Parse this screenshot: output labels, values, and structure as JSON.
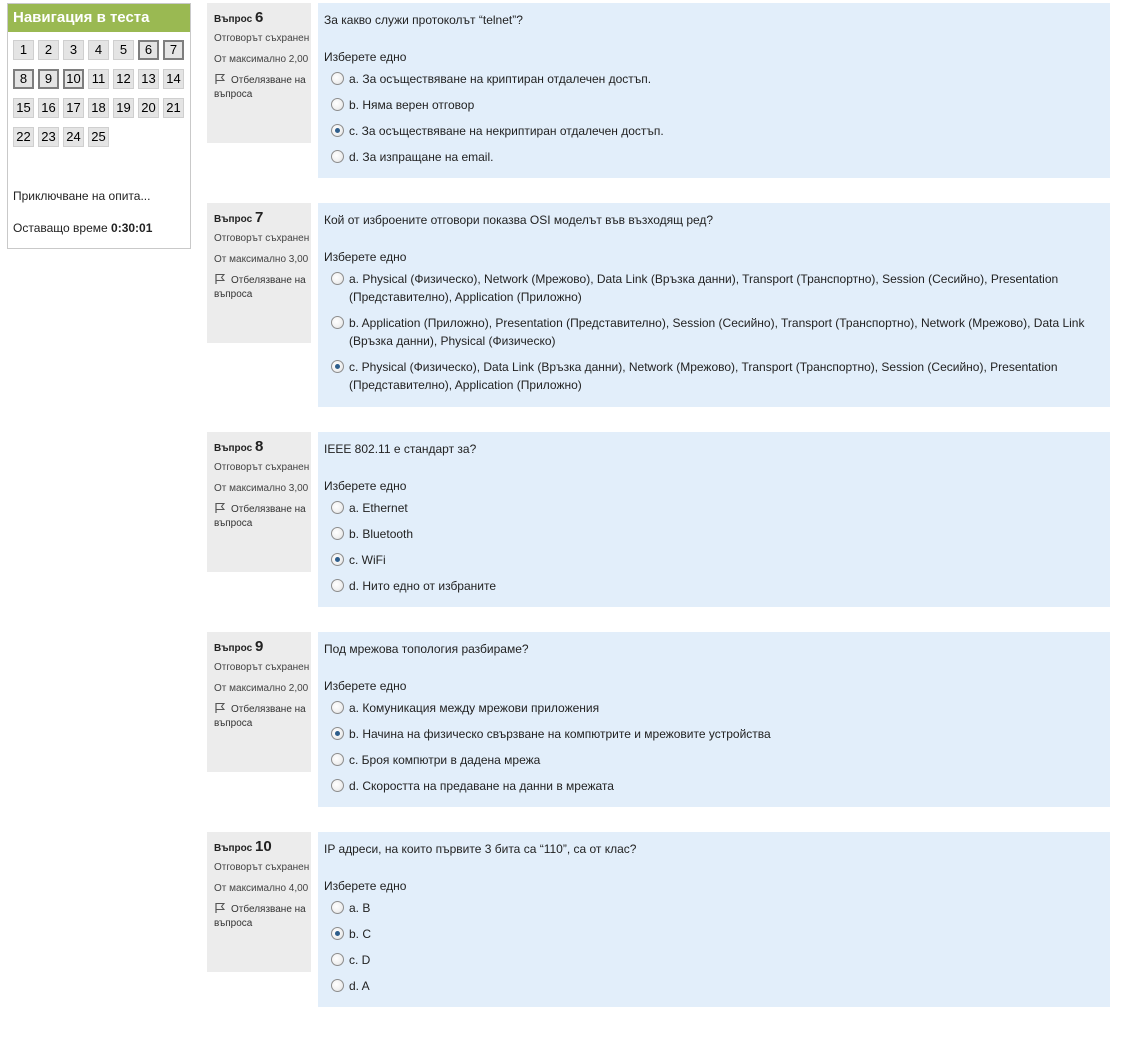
{
  "nav": {
    "title": "Навигация в теста",
    "buttons": [
      "1",
      "2",
      "3",
      "4",
      "5",
      "6",
      "7",
      "8",
      "9",
      "10",
      "11",
      "12",
      "13",
      "14",
      "15",
      "16",
      "17",
      "18",
      "19",
      "20",
      "21",
      "22",
      "23",
      "24",
      "25"
    ],
    "finish_label": "Приключване на опита...",
    "timer_label": "Оставащо време",
    "timer_value": "0:30:01"
  },
  "questions": [
    {
      "label": "Въпрос",
      "number": "6",
      "state": "Отговорът съхранен",
      "grade": "От максимално 2,00",
      "flag": "Отбелязване на въпроса",
      "text": "За какво служи протоколът “telnet”?",
      "prompt": "Изберете едно",
      "answers": [
        "a. За осъществяване на криптиран отдалечен достъп.",
        "b. Няма верен отговор",
        "c. За осъществяване на некриптиран отдалечен достъп.",
        "d. За изпращане на email."
      ],
      "selected": "c"
    },
    {
      "label": "Въпрос",
      "number": "7",
      "state": "Отговорът съхранен",
      "grade": "От максимално 3,00",
      "flag": "Отбелязване на въпроса",
      "text": "Кой от изброените отговори показва OSI моделът във възходящ ред?",
      "prompt": "Изберете едно",
      "answers": [
        "a. Physical (Физическо), Network (Мрежово), Data Link (Връзка данни), Transport (Транспортно), Session (Сесийно), Presentation (Представително), Application (Приложно)",
        "b. Application (Приложно), Presentation (Представително), Session (Сесийно), Transport (Транспортно), Network (Мрежово), Data Link (Връзка данни), Physical (Физическо)",
        "c. Physical (Физическо), Data Link (Връзка данни), Network (Мрежово), Transport (Транспортно), Session (Сесийно), Presentation (Представително), Application (Приложно)"
      ],
      "selected": "c"
    },
    {
      "label": "Въпрос",
      "number": "8",
      "state": "Отговорът съхранен",
      "grade": "От максимално 3,00",
      "flag": "Отбелязване на въпроса",
      "text": "IEEE 802.11 е стандарт за?",
      "prompt": "Изберете едно",
      "answers": [
        "a. Ethernet",
        "b. Bluetooth",
        "c. WiFi",
        "d. Нито едно от избраните"
      ],
      "selected": "c"
    },
    {
      "label": "Въпрос",
      "number": "9",
      "state": "Отговорът съхранен",
      "grade": "От максимално 2,00",
      "flag": "Отбелязване на въпроса",
      "text": "Под мрежова топология разбираме?",
      "prompt": "Изберете едно",
      "answers": [
        "a. Комуникация между мрежови приложения",
        "b. Начина на физическо свързване на компютрите и мрежовите устройства",
        "c. Броя компютри в дадена мрежа",
        "d. Скоростта на предаване на данни в мрежата"
      ],
      "selected": "b"
    },
    {
      "label": "Въпрос",
      "number": "10",
      "state": "Отговорът съхранен",
      "grade": "От максимално 4,00",
      "flag": "Отбелязване на въпроса",
      "text": "IP адреси, на които първите 3 бита са “110”, са от клас?",
      "prompt": "Изберете едно",
      "answers": [
        "a. B",
        "b. C",
        "c. D",
        "d. A"
      ],
      "selected": "b"
    }
  ]
}
